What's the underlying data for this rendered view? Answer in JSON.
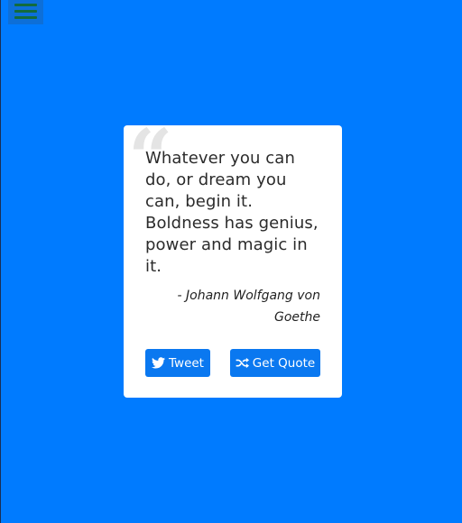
{
  "menu": {
    "icon": "hamburger-menu-icon",
    "bar_color": "#136b3d"
  },
  "quote": {
    "text": "Whatever you can do, or dream you can, begin it. Boldness has genius, power and magic in it.",
    "author": "- Johann Wolfgang von Goethe"
  },
  "buttons": {
    "tweet_label": "Tweet",
    "tweet_icon": "twitter-bird-icon",
    "get_quote_label": "Get Quote",
    "get_quote_icon": "shuffle-icon"
  },
  "colors": {
    "background": "#007bff",
    "button": "#0a78f0",
    "card": "#ffffff"
  }
}
